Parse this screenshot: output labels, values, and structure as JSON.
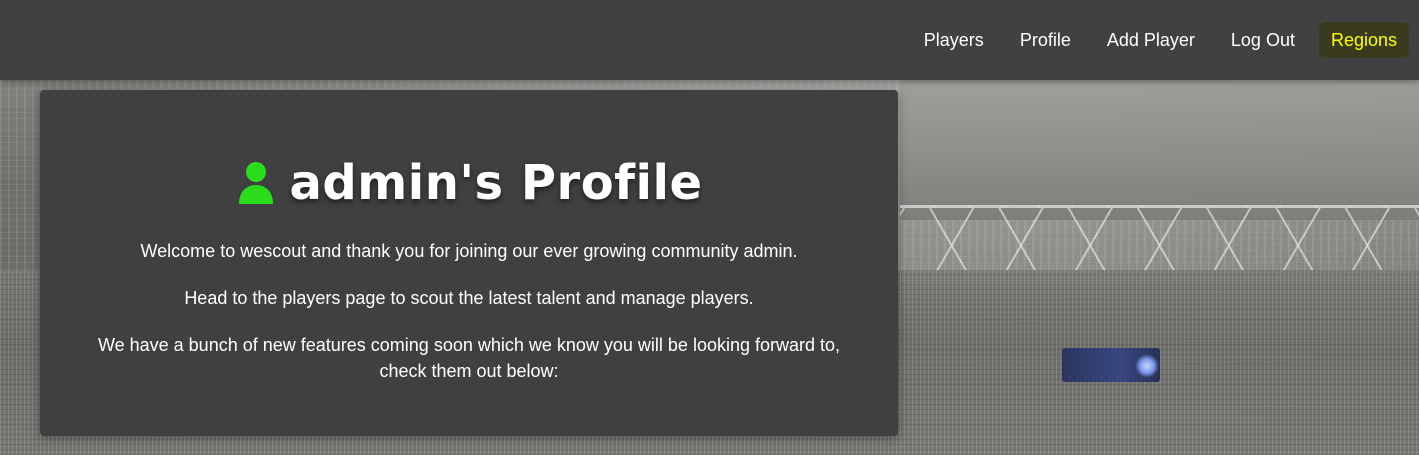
{
  "nav": {
    "items": [
      {
        "label": "Players"
      },
      {
        "label": "Profile"
      },
      {
        "label": "Add Player"
      },
      {
        "label": "Log Out"
      },
      {
        "label": "Regions"
      }
    ],
    "active_label": "Regions"
  },
  "profile": {
    "title": "admin's Profile",
    "paragraphs": [
      "Welcome to wescout and thank you for joining our ever growing community admin.",
      "Head to the players page to scout the latest talent and manage players.",
      "We have a bunch of new features coming soon which we know you will be looking forward to, check them out below:"
    ]
  },
  "icons": {
    "user": "user-icon"
  },
  "colors": {
    "navbar_bg": "#414141",
    "card_bg": "#404040",
    "text": "#ffffff",
    "active_nav": "#ffff00",
    "user_icon": "#2bdc1b"
  }
}
